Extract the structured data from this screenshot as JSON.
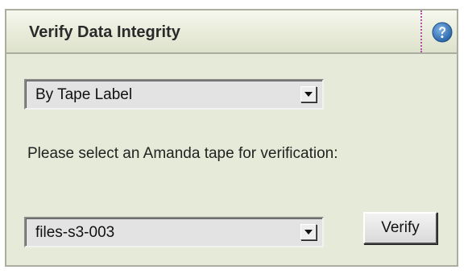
{
  "panel": {
    "title": "Verify Data Integrity",
    "help_icon": "question-mark-icon"
  },
  "method_select": {
    "selected": "By Tape Label"
  },
  "prompt": {
    "text": "Please select an Amanda tape for verification:"
  },
  "tape_select": {
    "selected": "files-s3-003"
  },
  "actions": {
    "verify_label": "Verify"
  },
  "colors": {
    "panel_background": "#e6ead8",
    "border": "#a9ae9f",
    "help_icon": "#2f6fb3"
  }
}
